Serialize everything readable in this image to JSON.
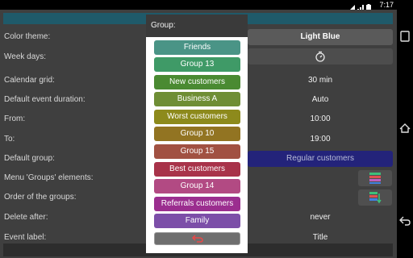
{
  "status": {
    "time": "7:17"
  },
  "rows": [
    {
      "label": "Color theme:",
      "value": "Light Blue"
    },
    {
      "label": "Week days:",
      "value": ""
    },
    {
      "label": "Calendar grid:",
      "value": "30 min"
    },
    {
      "label": "Default event   duration:",
      "value": "Auto"
    },
    {
      "label": "From:",
      "value": "10:00"
    },
    {
      "label": "To:",
      "value": "19:00"
    },
    {
      "label": "Default group:",
      "value": "Regular customers"
    },
    {
      "label": "Menu 'Groups' elements:",
      "value": ""
    },
    {
      "label": "Order of the groups:",
      "value": ""
    },
    {
      "label": "Delete after:",
      "value": "never"
    },
    {
      "label": "Event label:",
      "value": "Title"
    }
  ],
  "dialog": {
    "title": "Group:",
    "groups": [
      {
        "label": "Friends",
        "color": "#4a9486"
      },
      {
        "label": "Group 13",
        "color": "#3f9a67"
      },
      {
        "label": "New customers",
        "color": "#4a8a32"
      },
      {
        "label": "Business A",
        "color": "#6f8e35"
      },
      {
        "label": "Worst customers",
        "color": "#8d8a1c"
      },
      {
        "label": "Group 10",
        "color": "#927422"
      },
      {
        "label": "Group 15",
        "color": "#a15142"
      },
      {
        "label": "Best customers",
        "color": "#a8334a"
      },
      {
        "label": "Group 14",
        "color": "#b24a83"
      },
      {
        "label": "Referrals customers",
        "color": "#9b2e8f"
      },
      {
        "label": "Family",
        "color": "#7c4ea8"
      }
    ]
  }
}
